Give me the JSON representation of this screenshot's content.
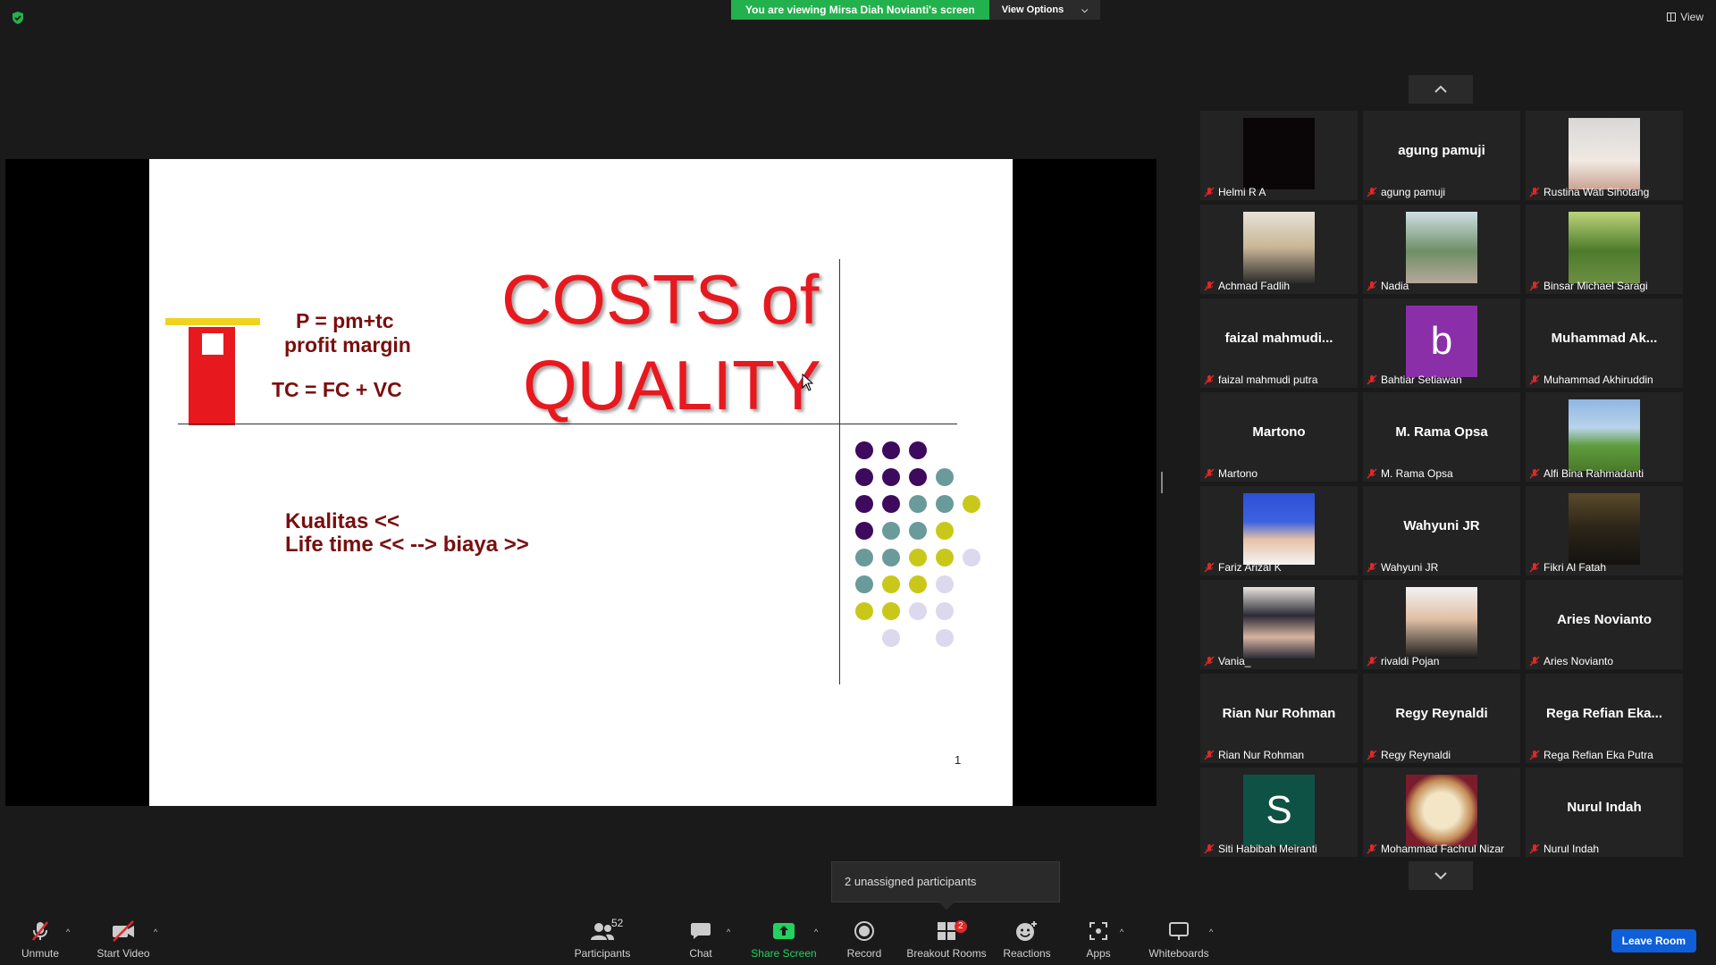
{
  "top": {
    "viewing_text": "You are viewing Mirsa Diah Novianti's screen",
    "view_options": "View Options",
    "view_label": "View"
  },
  "slide": {
    "title_line1": "COSTS of",
    "title_line2": "QUALITY",
    "formula1": "P = pm+tc",
    "formula2": "profit margin",
    "formula3": "TC = FC + VC",
    "kualitas": "Kualitas <<",
    "lifetime": "Life time << --> biaya >>",
    "page_number": "1"
  },
  "gallery": {
    "tiles": [
      {
        "label": "Helmi R A",
        "big": "",
        "kind": "black"
      },
      {
        "label": "agung pamuji",
        "big": "agung pamuji",
        "kind": "name"
      },
      {
        "label": "Rustina Wati Sihotang",
        "big": "",
        "kind": "photo-woman"
      },
      {
        "label": "Achmad Fadlih",
        "big": "",
        "kind": "photo-suit"
      },
      {
        "label": "Nadia",
        "big": "",
        "kind": "photo-outdoor"
      },
      {
        "label": "Binsar Michael Saragi",
        "big": "",
        "kind": "photo-tree"
      },
      {
        "label": "faizal mahmudi putra",
        "big": "faizal  mahmudi...",
        "kind": "name"
      },
      {
        "label": "Bahtiar Setiawan",
        "big": "b",
        "kind": "letter-purple"
      },
      {
        "label": "Muhammad Akhiruddin",
        "big": "Muhammad  Ak...",
        "kind": "name"
      },
      {
        "label": "Martono",
        "big": "Martono",
        "kind": "name"
      },
      {
        "label": "M. Rama Opsa",
        "big": "M. Rama Opsa",
        "kind": "name"
      },
      {
        "label": "Alfi Bina Rahmadanti",
        "big": "",
        "kind": "photo-park"
      },
      {
        "label": "Fariz Arizal K",
        "big": "",
        "kind": "photo-blue"
      },
      {
        "label": "Wahyuni JR",
        "big": "Wahyuni JR",
        "kind": "name"
      },
      {
        "label": "Fikri Al Fatah",
        "big": "",
        "kind": "photo-dark"
      },
      {
        "label": "Vania_",
        "big": "",
        "kind": "photo-hijab"
      },
      {
        "label": "rivaldi Pojan",
        "big": "",
        "kind": "photo-man"
      },
      {
        "label": "Aries Novianto",
        "big": "Aries Novianto",
        "kind": "name"
      },
      {
        "label": "Rian Nur Rohman",
        "big": "Rian Nur Rohman",
        "kind": "name"
      },
      {
        "label": "Regy Reynaldi",
        "big": "Regy Reynaldi",
        "kind": "name"
      },
      {
        "label": "Rega Refian Eka Putra",
        "big": "Rega  Refian  Eka...",
        "kind": "name"
      },
      {
        "label": "Siti Habibah Meiranti",
        "big": "S",
        "kind": "letter-teal"
      },
      {
        "label": "Mohammad Fachrul Nizar",
        "big": "",
        "kind": "photo-ornament"
      },
      {
        "label": "Nurul Indah",
        "big": "Nurul Indah",
        "kind": "name"
      }
    ]
  },
  "tooltip": {
    "text": "2 unassigned participants"
  },
  "toolbar": {
    "unmute": "Unmute",
    "start_video": "Start Video",
    "participants": "Participants",
    "participants_count": "52",
    "chat": "Chat",
    "share_screen": "Share Screen",
    "record": "Record",
    "breakout_rooms": "Breakout Rooms",
    "breakout_badge": "2",
    "reactions": "Reactions",
    "apps": "Apps",
    "whiteboards": "Whiteboards",
    "leave_room": "Leave Room"
  },
  "colors": {
    "accent_green": "#23b14d",
    "slide_red": "#e8181f",
    "slide_darkred": "#7a0e0e",
    "leave_blue": "#0e5fd8",
    "muted_red": "#e02828"
  }
}
